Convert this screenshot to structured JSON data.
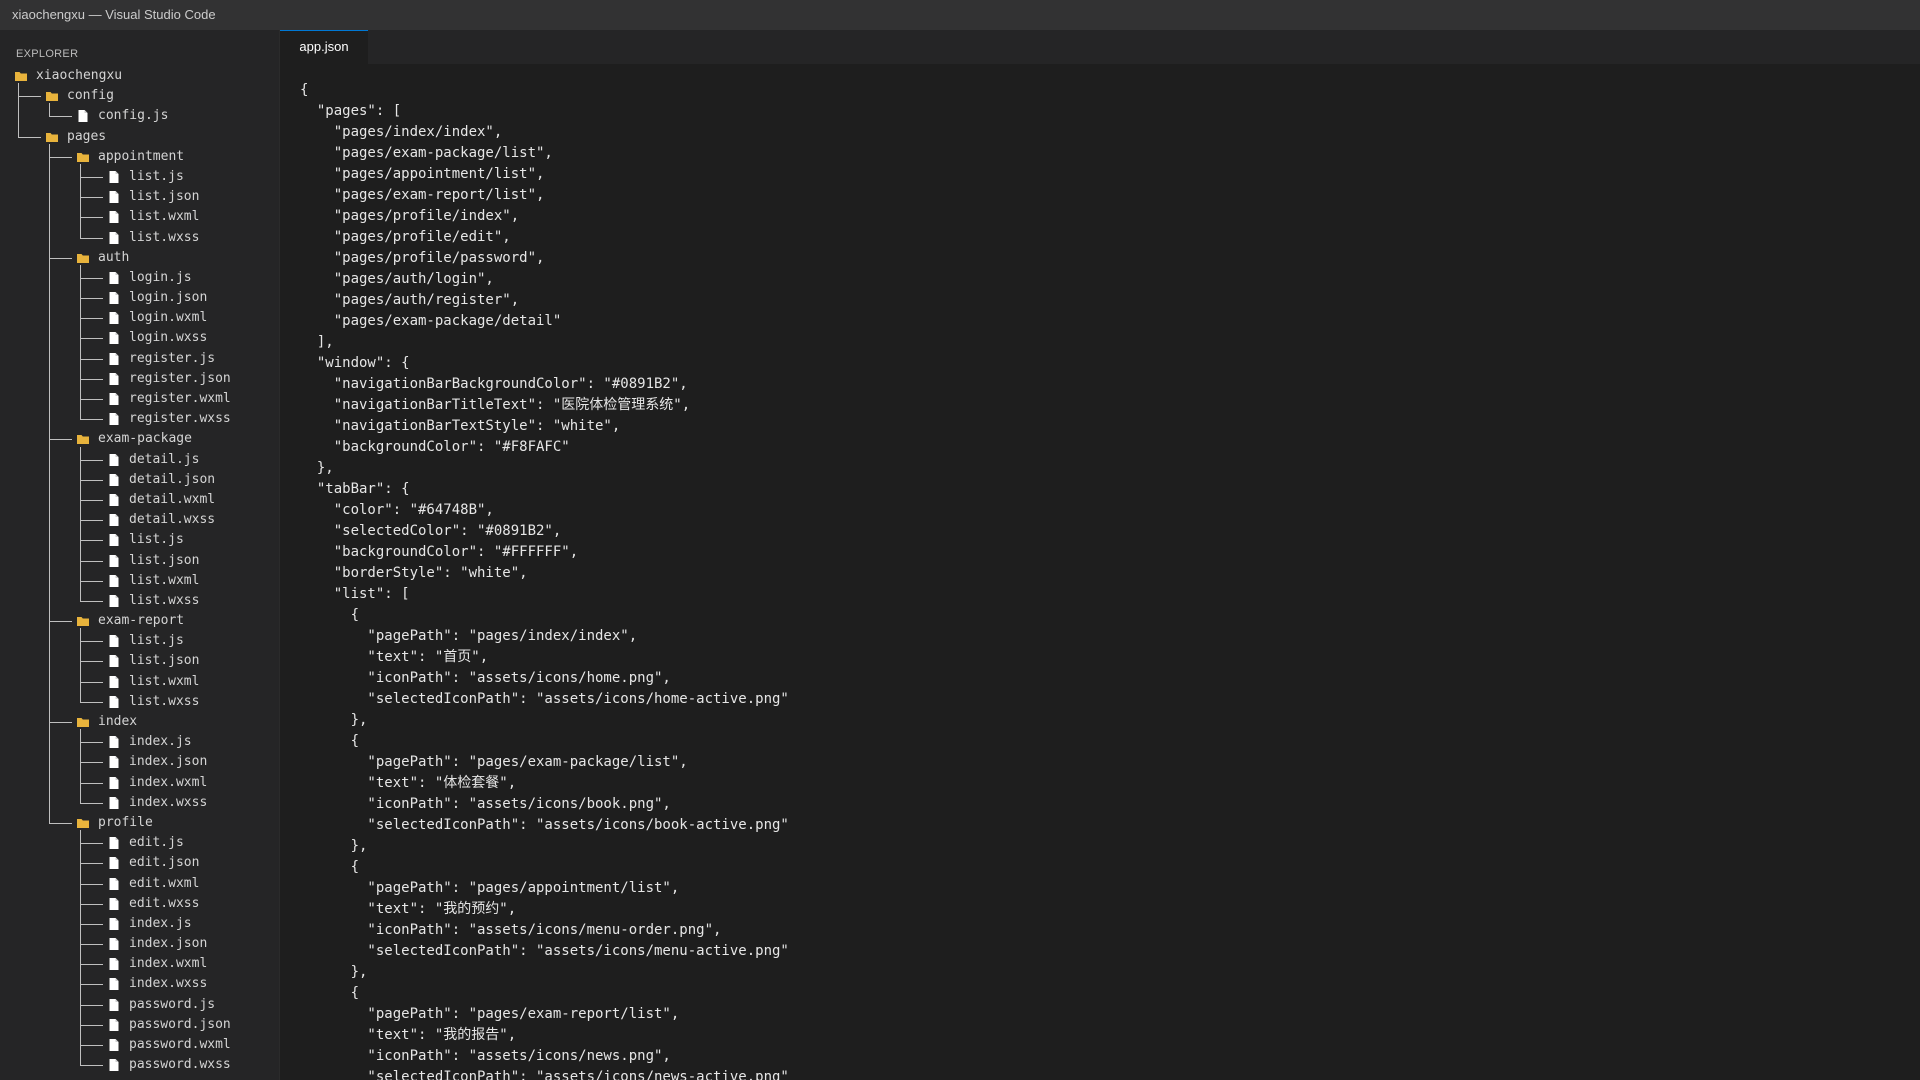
{
  "window": {
    "title": "xiaochengxu — Visual Studio Code"
  },
  "explorer": {
    "header": "EXPLORER",
    "tree": [
      {
        "label": "xiaochengxu",
        "type": "folder",
        "depth": 0
      },
      {
        "label": "config",
        "type": "folder",
        "depth": 1
      },
      {
        "label": "config.js",
        "type": "file",
        "depth": 2
      },
      {
        "label": "pages",
        "type": "folder",
        "depth": 1
      },
      {
        "label": "appointment",
        "type": "folder",
        "depth": 2
      },
      {
        "label": "list.js",
        "type": "file",
        "depth": 3
      },
      {
        "label": "list.json",
        "type": "file",
        "depth": 3
      },
      {
        "label": "list.wxml",
        "type": "file",
        "depth": 3
      },
      {
        "label": "list.wxss",
        "type": "file",
        "depth": 3
      },
      {
        "label": "auth",
        "type": "folder",
        "depth": 2
      },
      {
        "label": "login.js",
        "type": "file",
        "depth": 3
      },
      {
        "label": "login.json",
        "type": "file",
        "depth": 3
      },
      {
        "label": "login.wxml",
        "type": "file",
        "depth": 3
      },
      {
        "label": "login.wxss",
        "type": "file",
        "depth": 3
      },
      {
        "label": "register.js",
        "type": "file",
        "depth": 3
      },
      {
        "label": "register.json",
        "type": "file",
        "depth": 3
      },
      {
        "label": "register.wxml",
        "type": "file",
        "depth": 3
      },
      {
        "label": "register.wxss",
        "type": "file",
        "depth": 3
      },
      {
        "label": "exam-package",
        "type": "folder",
        "depth": 2
      },
      {
        "label": "detail.js",
        "type": "file",
        "depth": 3
      },
      {
        "label": "detail.json",
        "type": "file",
        "depth": 3
      },
      {
        "label": "detail.wxml",
        "type": "file",
        "depth": 3
      },
      {
        "label": "detail.wxss",
        "type": "file",
        "depth": 3
      },
      {
        "label": "list.js",
        "type": "file",
        "depth": 3
      },
      {
        "label": "list.json",
        "type": "file",
        "depth": 3
      },
      {
        "label": "list.wxml",
        "type": "file",
        "depth": 3
      },
      {
        "label": "list.wxss",
        "type": "file",
        "depth": 3
      },
      {
        "label": "exam-report",
        "type": "folder",
        "depth": 2
      },
      {
        "label": "list.js",
        "type": "file",
        "depth": 3
      },
      {
        "label": "list.json",
        "type": "file",
        "depth": 3
      },
      {
        "label": "list.wxml",
        "type": "file",
        "depth": 3
      },
      {
        "label": "list.wxss",
        "type": "file",
        "depth": 3
      },
      {
        "label": "index",
        "type": "folder",
        "depth": 2
      },
      {
        "label": "index.js",
        "type": "file",
        "depth": 3
      },
      {
        "label": "index.json",
        "type": "file",
        "depth": 3
      },
      {
        "label": "index.wxml",
        "type": "file",
        "depth": 3
      },
      {
        "label": "index.wxss",
        "type": "file",
        "depth": 3
      },
      {
        "label": "profile",
        "type": "folder",
        "depth": 2
      },
      {
        "label": "edit.js",
        "type": "file",
        "depth": 3
      },
      {
        "label": "edit.json",
        "type": "file",
        "depth": 3
      },
      {
        "label": "edit.wxml",
        "type": "file",
        "depth": 3
      },
      {
        "label": "edit.wxss",
        "type": "file",
        "depth": 3
      },
      {
        "label": "index.js",
        "type": "file",
        "depth": 3
      },
      {
        "label": "index.json",
        "type": "file",
        "depth": 3
      },
      {
        "label": "index.wxml",
        "type": "file",
        "depth": 3
      },
      {
        "label": "index.wxss",
        "type": "file",
        "depth": 3
      },
      {
        "label": "password.js",
        "type": "file",
        "depth": 3
      },
      {
        "label": "password.json",
        "type": "file",
        "depth": 3
      },
      {
        "label": "password.wxml",
        "type": "file",
        "depth": 3
      },
      {
        "label": "password.wxss",
        "type": "file",
        "depth": 3
      }
    ]
  },
  "editor": {
    "tab_label": "app.json",
    "lines": [
      "{",
      "  \"pages\": [",
      "    \"pages/index/index\",",
      "    \"pages/exam-package/list\",",
      "    \"pages/appointment/list\",",
      "    \"pages/exam-report/list\",",
      "    \"pages/profile/index\",",
      "    \"pages/profile/edit\",",
      "    \"pages/profile/password\",",
      "    \"pages/auth/login\",",
      "    \"pages/auth/register\",",
      "    \"pages/exam-package/detail\"",
      "  ],",
      "  \"window\": {",
      "    \"navigationBarBackgroundColor\": \"#0891B2\",",
      "    \"navigationBarTitleText\": \"医院体检管理系统\",",
      "    \"navigationBarTextStyle\": \"white\",",
      "    \"backgroundColor\": \"#F8FAFC\"",
      "  },",
      "  \"tabBar\": {",
      "    \"color\": \"#64748B\",",
      "    \"selectedColor\": \"#0891B2\",",
      "    \"backgroundColor\": \"#FFFFFF\",",
      "    \"borderStyle\": \"white\",",
      "    \"list\": [",
      "      {",
      "        \"pagePath\": \"pages/index/index\",",
      "        \"text\": \"首页\",",
      "        \"iconPath\": \"assets/icons/home.png\",",
      "        \"selectedIconPath\": \"assets/icons/home-active.png\"",
      "      },",
      "      {",
      "        \"pagePath\": \"pages/exam-package/list\",",
      "        \"text\": \"体检套餐\",",
      "        \"iconPath\": \"assets/icons/book.png\",",
      "        \"selectedIconPath\": \"assets/icons/book-active.png\"",
      "      },",
      "      {",
      "        \"pagePath\": \"pages/appointment/list\",",
      "        \"text\": \"我的预约\",",
      "        \"iconPath\": \"assets/icons/menu-order.png\",",
      "        \"selectedIconPath\": \"assets/icons/menu-active.png\"",
      "      },",
      "      {",
      "        \"pagePath\": \"pages/exam-report/list\",",
      "        \"text\": \"我的报告\",",
      "        \"iconPath\": \"assets/icons/news.png\",",
      "        \"selectedIconPath\": \"assets/icons/news-active.png\""
    ]
  },
  "colors": {
    "folder_icon": "#e8b33c",
    "file_icon": "#ffffff",
    "tab_accent": "#0078d4"
  }
}
